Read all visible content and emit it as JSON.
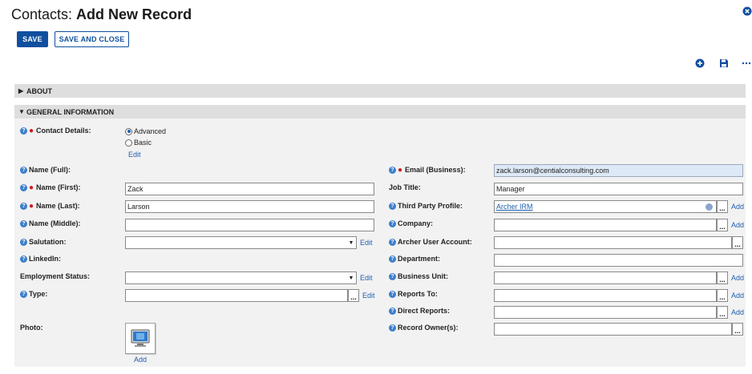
{
  "header": {
    "module": "Contacts:",
    "action": "Add New Record"
  },
  "toolbar": {
    "save_label": "SAVE",
    "save_close_label": "SAVE AND CLOSE",
    "icons": [
      "add-circle-icon",
      "save-disk-icon",
      "more-dots-icon",
      "close-icon"
    ]
  },
  "sections": {
    "about": {
      "label": "ABOUT",
      "expanded": false
    },
    "general": {
      "label": "GENERAL INFORMATION",
      "expanded": true
    }
  },
  "left": {
    "contact_details": {
      "label": "Contact Details:",
      "options": [
        "Advanced",
        "Basic"
      ],
      "selected": "Advanced",
      "edit": "Edit"
    },
    "name_full": {
      "label": "Name (Full):"
    },
    "name_first": {
      "label": "Name (First):",
      "value": "Zack"
    },
    "name_last": {
      "label": "Name (Last):",
      "value": "Larson"
    },
    "name_middle": {
      "label": "Name (Middle):",
      "value": ""
    },
    "salutation": {
      "label": "Salutation:",
      "value": "",
      "edit": "Edit"
    },
    "linkedin": {
      "label": "LinkedIn:"
    },
    "employment_status": {
      "label": "Employment Status:",
      "value": "",
      "edit": "Edit"
    },
    "type": {
      "label": "Type:",
      "value": "",
      "lookup": "...",
      "edit": "Edit"
    },
    "photo": {
      "label": "Photo:",
      "add": "Add"
    }
  },
  "right": {
    "email": {
      "label": "Email (Business):",
      "value": "zack.larson@centialconsulting.com"
    },
    "job_title": {
      "label": "Job Title:",
      "value": "Manager"
    },
    "third_party": {
      "label": "Third Party Profile:",
      "value": "Archer IRM",
      "lookup": "...",
      "add": "Add"
    },
    "company": {
      "label": "Company:",
      "value": "",
      "lookup": "...",
      "add": "Add"
    },
    "archer_user": {
      "label": "Archer User Account:",
      "value": "",
      "lookup": "..."
    },
    "department": {
      "label": "Department:",
      "value": ""
    },
    "business_unit": {
      "label": "Business Unit:",
      "value": "",
      "lookup": "...",
      "add": "Add"
    },
    "reports_to": {
      "label": "Reports To:",
      "value": "",
      "lookup": "...",
      "add": "Add"
    },
    "direct_reports": {
      "label": "Direct Reports:",
      "value": "",
      "lookup": "...",
      "add": "Add"
    },
    "record_owners": {
      "label": "Record Owner(s):",
      "value": "",
      "lookup": "..."
    }
  },
  "colors": {
    "primary": "#0f4f9f",
    "link": "#1f5fb0",
    "help": "#3d7fcc",
    "required": "#c81e1e",
    "section_header": "#dedede",
    "section_body": "#f2f2f2"
  }
}
